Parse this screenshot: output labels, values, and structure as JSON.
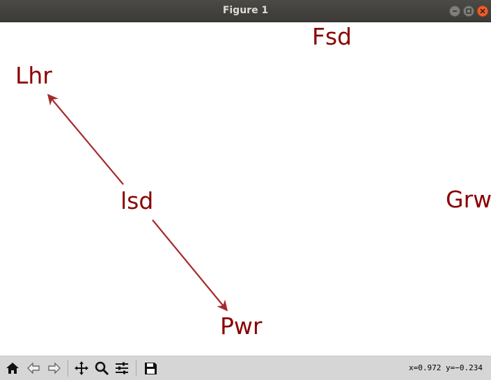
{
  "window": {
    "title": "Figure 1"
  },
  "window_buttons": [
    "minimize-icon",
    "maximize-icon",
    "close-icon"
  ],
  "figure": {
    "text_color": "#8b0000",
    "arrow_color": "#a52a2a",
    "nodes": [
      "Fsd",
      "Lhr",
      "lsd",
      "Grw",
      "Pwr"
    ],
    "arrows": [
      {
        "from": "lsd",
        "to": "Lhr"
      },
      {
        "from": "lsd",
        "to": "Pwr"
      }
    ]
  },
  "toolbar": {
    "buttons": [
      "home-icon",
      "back-icon",
      "forward-icon",
      "pan-icon",
      "zoom-icon",
      "configure-subplots-icon",
      "save-icon"
    ],
    "coordinates": "x=0.972  y=−0.234"
  }
}
